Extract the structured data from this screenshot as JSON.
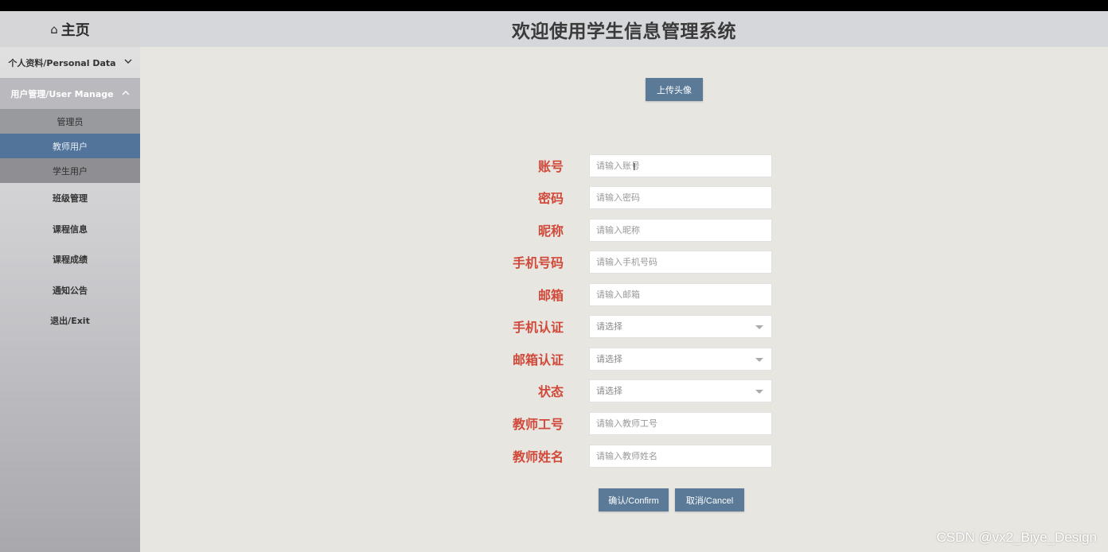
{
  "header": {
    "title": "欢迎使用学生信息管理系统"
  },
  "sidebar": {
    "home": {
      "icon": "home-icon",
      "glyph": "⌂",
      "label": "主页"
    },
    "personal": {
      "label": "个人资料/Personal Data",
      "chevron": "chevron-down-icon"
    },
    "user_manage": {
      "label": "用户管理/User Manage",
      "chevron": "chevron-up-icon",
      "sub_items": [
        {
          "label": "管理员"
        },
        {
          "label": "教师用户"
        },
        {
          "label": "学生用户"
        }
      ]
    },
    "links": [
      {
        "label": "班级管理"
      },
      {
        "label": "课程信息"
      },
      {
        "label": "课程成绩"
      },
      {
        "label": "通知公告"
      },
      {
        "label": "退出/Exit"
      }
    ]
  },
  "upload": {
    "label": "上传头像"
  },
  "form": {
    "fields": [
      {
        "label": "账号",
        "placeholder": "请输入账号",
        "type": "input"
      },
      {
        "label": "密码",
        "placeholder": "请输入密码",
        "type": "input"
      },
      {
        "label": "昵称",
        "placeholder": "请输入昵称",
        "type": "input"
      },
      {
        "label": "手机号码",
        "placeholder": "请输入手机号码",
        "type": "input"
      },
      {
        "label": "邮箱",
        "placeholder": "请输入邮箱",
        "type": "input"
      },
      {
        "label": "手机认证",
        "placeholder": "请选择",
        "type": "select"
      },
      {
        "label": "邮箱认证",
        "placeholder": "请选择",
        "type": "select"
      },
      {
        "label": "状态",
        "placeholder": "请选择",
        "type": "select"
      },
      {
        "label": "教师工号",
        "placeholder": "请输入教师工号",
        "type": "input"
      },
      {
        "label": "教师姓名",
        "placeholder": "请输入教师姓名",
        "type": "input"
      }
    ],
    "confirm_label": "确认/Confirm",
    "cancel_label": "取消/Cancel"
  },
  "watermark": "CSDN @vx2_Biye_Design",
  "colors": {
    "accent": "#5a7a98",
    "label_red": "#d0493a",
    "active_item": "#53749a"
  }
}
